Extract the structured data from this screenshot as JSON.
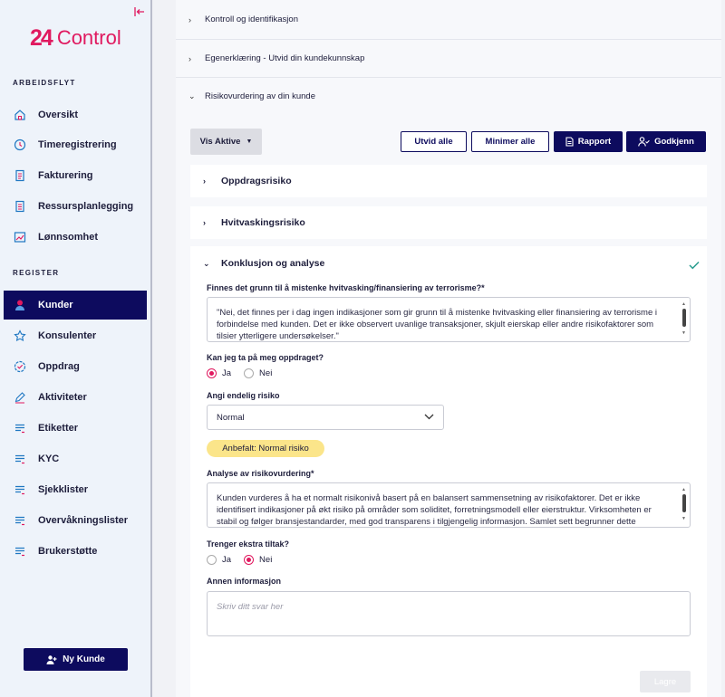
{
  "sidebar": {
    "logo_mark": "24",
    "logo_word": "Control",
    "section_workflow": "ARBEIDSFLYT",
    "section_register": "REGISTER",
    "workflow_items": [
      {
        "label": "Oversikt",
        "icon": "home-icon"
      },
      {
        "label": "Timeregistrering",
        "icon": "clock-icon"
      },
      {
        "label": "Fakturering",
        "icon": "invoice-icon"
      },
      {
        "label": "Ressursplanlegging",
        "icon": "document-icon"
      },
      {
        "label": "Lønnsomhet",
        "icon": "chart-icon"
      }
    ],
    "register_items": [
      {
        "label": "Kunder",
        "icon": "user-icon"
      },
      {
        "label": "Konsulenter",
        "icon": "star-icon"
      },
      {
        "label": "Oppdrag",
        "icon": "badge-icon"
      },
      {
        "label": "Aktiviteter",
        "icon": "pencil-icon"
      },
      {
        "label": "Etiketter",
        "icon": "list-icon"
      },
      {
        "label": "KYC",
        "icon": "list-icon"
      },
      {
        "label": "Sjekklister",
        "icon": "list-icon"
      },
      {
        "label": "Overvåkningslister",
        "icon": "list-icon"
      },
      {
        "label": "Brukerstøtte",
        "icon": "list-icon"
      }
    ],
    "new_customer": "Ny Kunde"
  },
  "accordions": {
    "kontroll": "Kontroll og identifikasjon",
    "egenerklaering": "Egenerklæring - Utvid din kundekunnskap",
    "risiko": "Risikovurdering av din kunde"
  },
  "toolbar": {
    "filter": "Vis Aktive",
    "expand_all": "Utvid alle",
    "collapse_all": "Minimer alle",
    "report": "Rapport",
    "approve": "Godkjenn"
  },
  "sections": {
    "oppdrag": "Oppdragsrisiko",
    "hvitvasking": "Hvitvaskingsrisiko",
    "konklusjon": "Konklusjon og analyse"
  },
  "form": {
    "q1_label": "Finnes det grunn til å mistenke hvitvasking/finansiering av terrorisme?*",
    "q1_value": "\"Nei, det finnes per i dag ingen indikasjoner som gir grunn til å mistenke hvitvasking eller finansiering av terrorisme i forbindelse med kunden. Det er ikke observert uvanlige transaksjoner, skjult eierskap eller andre risikofaktorer som tilsier ytterligere undersøkelser.\"",
    "q2_label": "Kan jeg ta på meg oppdraget?",
    "q2_yes": "Ja",
    "q2_no": "Nei",
    "q2_selected": "Ja",
    "risk_label": "Angi endelig risiko",
    "risk_value": "Normal",
    "recommended": "Anbefalt: Normal risiko",
    "analysis_label": "Analyse av risikovurdering*",
    "analysis_value": "Kunden vurderes å ha et normalt risikonivå basert på en balansert sammensetning av risikofaktorer. Det er ikke identifisert indikasjoner på økt risiko på områder som soliditet, forretningsmodell eller eierstruktur. Virksomheten er stabil og følger bransjestandarder, med god transparens i tilgjengelig informasjon. Samlet sett begrunner dette",
    "extra_label": "Trenger ekstra tiltak?",
    "extra_yes": "Ja",
    "extra_no": "Nei",
    "extra_selected": "Nei",
    "other_label": "Annen informasjon",
    "other_placeholder": "Skriv ditt svar her",
    "save": "Lagre"
  },
  "colors": {
    "brand": "#e0195f",
    "navy": "#0d0b5e",
    "check": "#2a9d8f",
    "recommend_bg": "#fbe58a"
  }
}
